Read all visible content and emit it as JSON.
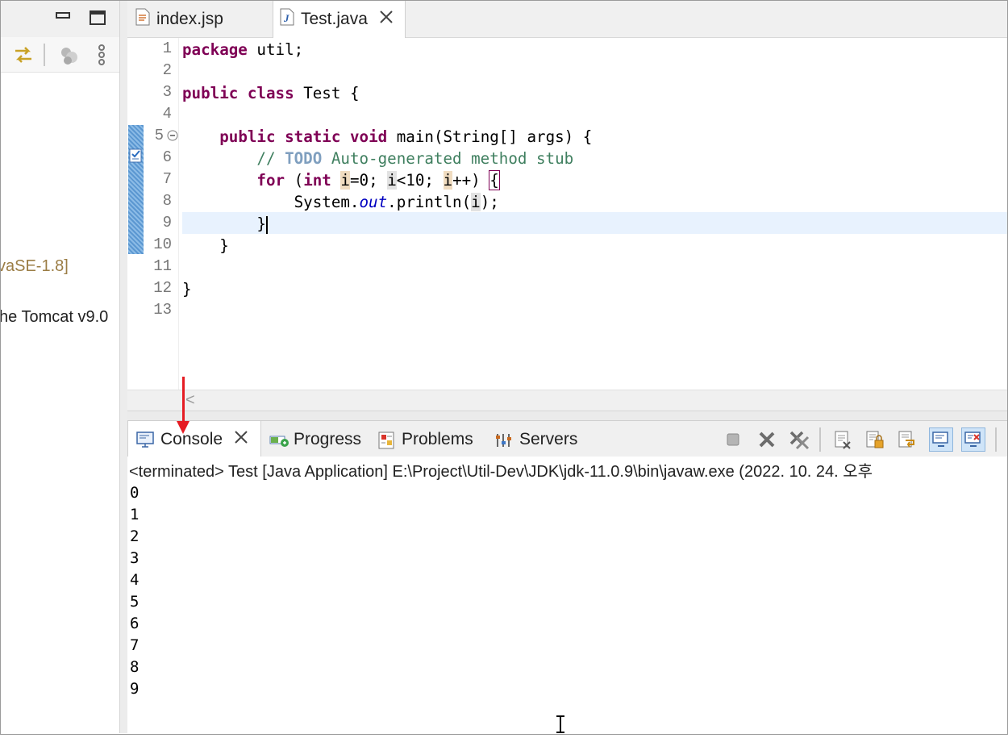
{
  "editor": {
    "tabs": [
      {
        "label": "index.jsp"
      },
      {
        "label": "Test.java"
      }
    ],
    "line_numbers": [
      "1",
      "2",
      "3",
      "4",
      "5",
      "6",
      "7",
      "8",
      "9",
      "10",
      "11",
      "12",
      "13"
    ],
    "code": {
      "l1_kw": "package",
      "l1_rest": " util;",
      "l3_kw1": "public",
      "l3_kw2": "class",
      "l3_rest": " Test {",
      "l5_kw1": "public",
      "l5_kw2": "static",
      "l5_kw3": "void",
      "l5_rest": " main(String[] args) {",
      "l6_comment": "// ",
      "l6_todo": "TODO",
      "l6_rest": " Auto-generated method stub",
      "l7_kw1": "for",
      "l7_a": " (",
      "l7_kw2": "int",
      "l7_b": " ",
      "l7_i1": "i",
      "l7_c": "=0; ",
      "l7_i2": "i",
      "l7_d": "<10; ",
      "l7_i3": "i",
      "l7_e": "++) ",
      "l7_brace": "{",
      "l8_a": "System.",
      "l8_field": "out",
      "l8_b": ".println(",
      "l8_i": "i",
      "l8_c": ");",
      "l9": "}",
      "l10": "}",
      "l12": "}"
    },
    "scroll_left": "<"
  },
  "explorer": {
    "jre_label": "vaSE-1.8]",
    "server_label": "he Tomcat v9.0"
  },
  "console": {
    "tabs": [
      {
        "label": "Console"
      },
      {
        "label": "Progress"
      },
      {
        "label": "Problems"
      },
      {
        "label": "Servers"
      }
    ],
    "status": "<terminated> Test [Java Application] E:\\Project\\Util-Dev\\JDK\\jdk-11.0.9\\bin\\javaw.exe  (2022. 10. 24. 오후 ",
    "output": [
      "0",
      "1",
      "2",
      "3",
      "4",
      "5",
      "6",
      "7",
      "8",
      "9"
    ]
  },
  "colors": {
    "keyword": "#7f0055",
    "comment": "#3f7f5f",
    "todo": "#7f9fbf",
    "field": "#0000c0",
    "annotation_arrow": "#e51c23"
  }
}
